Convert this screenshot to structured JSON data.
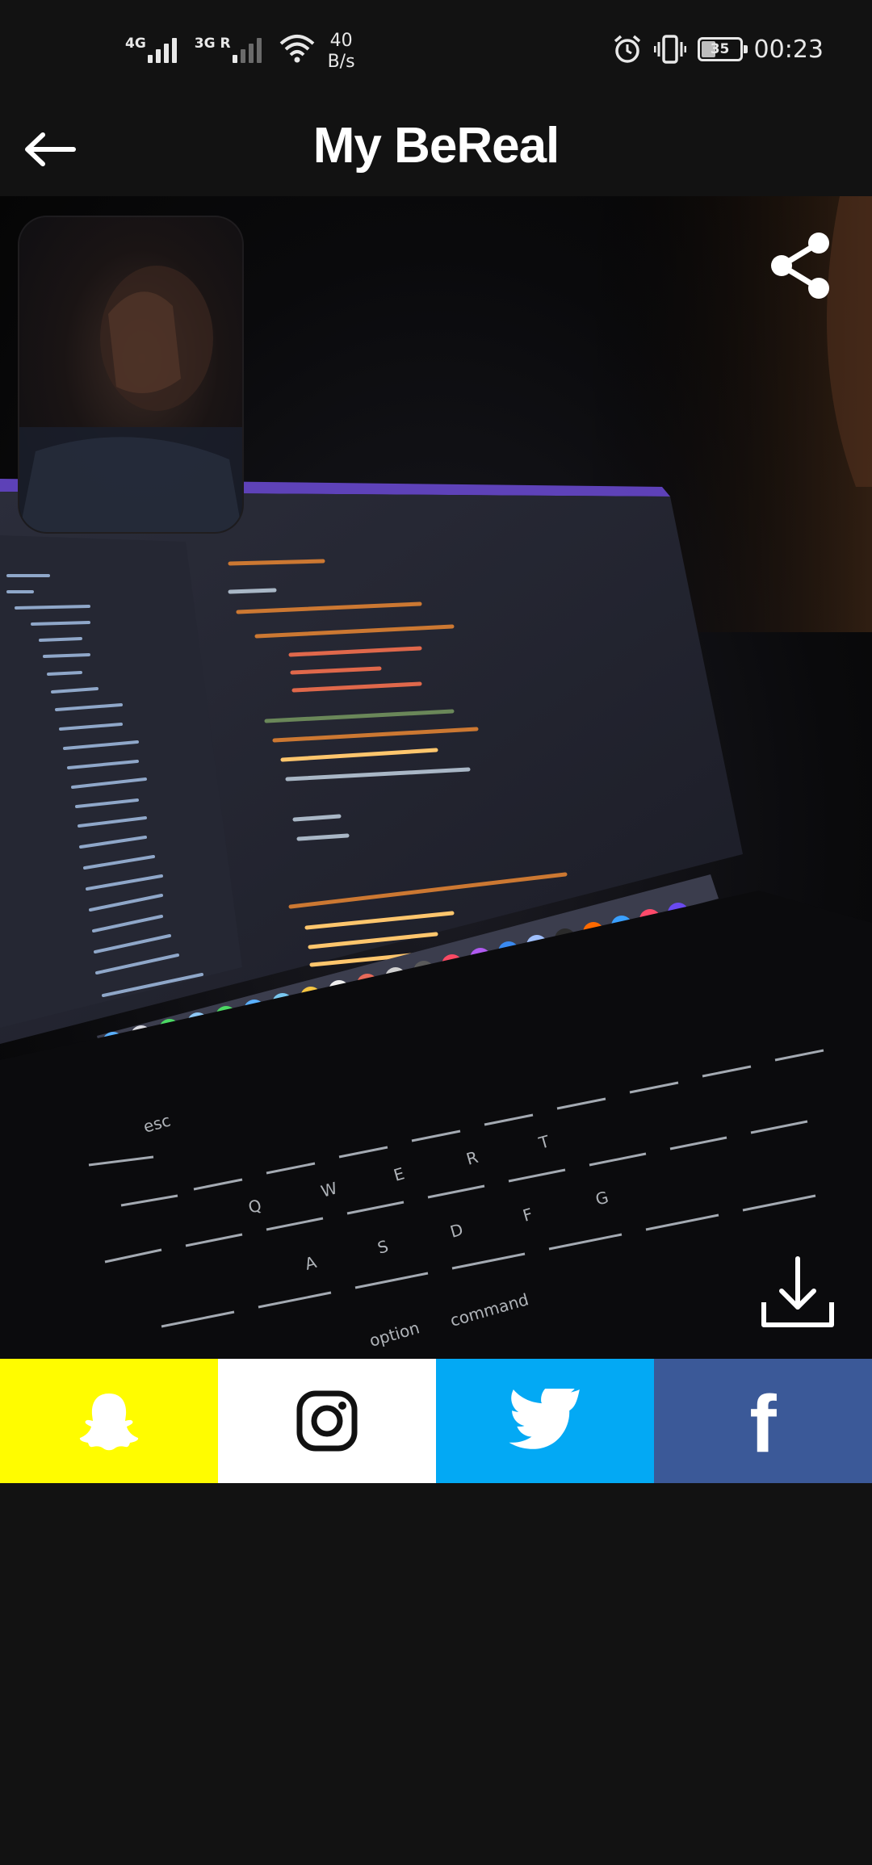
{
  "status_bar": {
    "network_1": "4G",
    "network_2": "3G R",
    "speed_value": "40",
    "speed_unit": "B/s",
    "battery_level": "35",
    "time": "00:23",
    "icons": [
      "signal-icon",
      "wifi-icon",
      "alarm-icon",
      "vibrate-icon",
      "battery-icon"
    ]
  },
  "header": {
    "title": "My BeReal",
    "back_icon": "arrow-left-icon"
  },
  "photo": {
    "share_icon": "share-icon",
    "download_icon": "download-icon"
  },
  "share_targets": [
    {
      "name": "snapchat",
      "icon": "snapchat-ghost-icon",
      "color": "#fffc00"
    },
    {
      "name": "instagram",
      "icon": "instagram-icon",
      "color": "#ffffff"
    },
    {
      "name": "twitter",
      "icon": "twitter-bird-icon",
      "color": "#03a9f4"
    },
    {
      "name": "facebook",
      "icon": "facebook-icon",
      "color": "#3b5998",
      "glyph": "f"
    }
  ],
  "colors": {
    "background": "#121212",
    "snapchat": "#fffc00",
    "twitter": "#03a9f4",
    "facebook": "#3b5998"
  }
}
